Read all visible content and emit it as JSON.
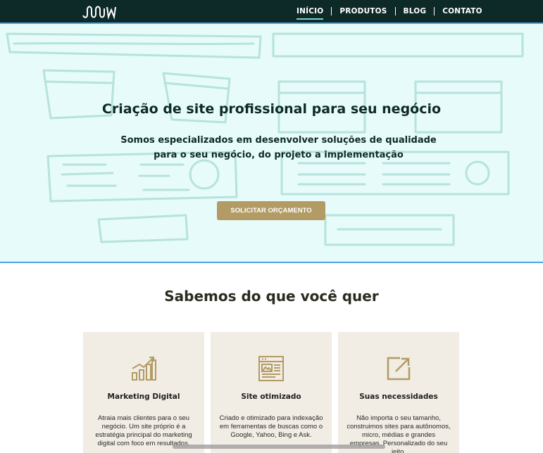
{
  "nav": {
    "items": [
      {
        "label": "INÍCIO",
        "active": true
      },
      {
        "label": "PRODUTOS",
        "active": false
      },
      {
        "label": "BLOG",
        "active": false
      },
      {
        "label": "CONTATO",
        "active": false
      }
    ]
  },
  "hero": {
    "title": "Criação de site profissional para seu negócio",
    "subtitle_line1": "Somos especializados em desenvolver soluções de qualidade",
    "subtitle_line2": "para o seu negócio, do projeto a implementação",
    "cta_label": "SOLICITAR ORÇAMENTO"
  },
  "section": {
    "title": "Sabemos do que você quer",
    "cards": [
      {
        "icon": "chart-growth-icon",
        "title": "Marketing Digital",
        "text": "Atraia mais clientes para o seu negócio. Um site próprio é a estratégia principal do marketing digital com foco em resultados."
      },
      {
        "icon": "web-layout-icon",
        "title": "Site otimizado",
        "text": "Criado e otimizado para indexação em ferramentas de buscas como o Google, Yahoo, Bing e Ask."
      },
      {
        "icon": "external-link-icon",
        "title": "Suas necessidades",
        "text": "Não importa o seu tamanho, construimos sites para autônomos, micro, médias e grandes empresas. Personalizado do seu jeito."
      }
    ]
  },
  "colors": {
    "header_bg": "#0e2a28",
    "hero_bg": "#e7fbfb",
    "accent_gold": "#b29b64",
    "card_bg": "#f1ece4",
    "sketch_line": "#b6e3dc"
  }
}
